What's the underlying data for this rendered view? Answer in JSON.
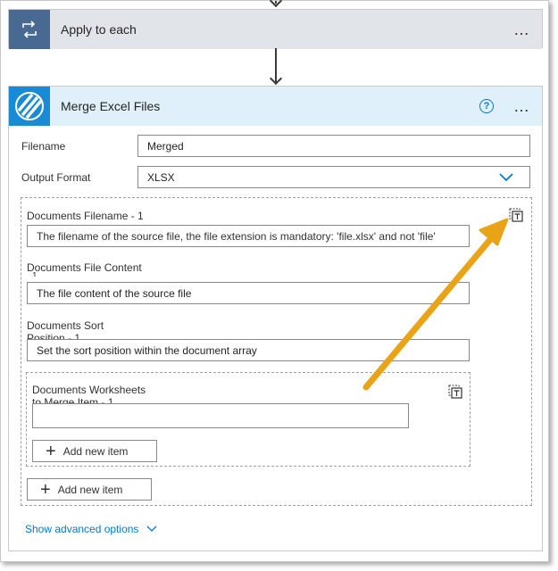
{
  "apply_card": {
    "title": "Apply to each",
    "more": "…"
  },
  "merge_card": {
    "title": "Merge Excel Files",
    "help": "?",
    "more": "…"
  },
  "fields": {
    "filename_label": "Filename",
    "filename_value": "Merged",
    "output_format_label": "Output Format",
    "output_format_value": "XLSX"
  },
  "documents": {
    "filename_label": "Documents Filename - 1",
    "filename_placeholder": "The filename of the source file, the file extension is mandatory: 'file.xlsx' and not 'file'",
    "content_label": "Documents File Content",
    "content_label_overflow": "1",
    "content_placeholder": "The file content of the source file",
    "sort_label": "Documents Sort",
    "sort_label_overflow": "Position - 1",
    "sort_placeholder": "Set the sort position within the document array",
    "worksheets_label": "Documents Worksheets",
    "worksheets_label_overflow": "to Merge Item - 1",
    "worksheets_value": "",
    "inner_add_label": "Add new item",
    "outer_add_label": "Add new item"
  },
  "advanced": {
    "label": "Show advanced options"
  },
  "colors": {
    "apply_icon_bg": "#486991",
    "apply_header_bg": "#e1e4e8",
    "merge_icon_bg": "#1a8ad4",
    "merge_header_bg": "#dff0fb",
    "link": "#0078d4",
    "arrow": "#f5a623"
  },
  "icons": {
    "apply": "loop-icon",
    "merge": "merge-stripes-icon",
    "help": "help-circle-icon",
    "dropdown": "chevron-down-icon",
    "switch_mode": "switch-input-mode-icon",
    "add": "plus-icon"
  }
}
